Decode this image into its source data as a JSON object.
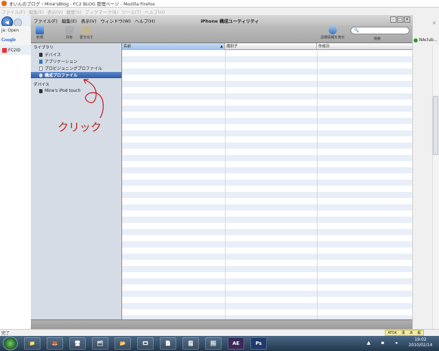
{
  "firefox": {
    "title": "まいんのブログ・Mine'sBlog - FC2 BLOG 管理ページ - Mozilla Firefox",
    "menu": [
      "ファイル(F)",
      "編集(E)",
      "表示(V)",
      "履歴(S)",
      "ブックマーク(B)",
      "ツール(T)",
      "ヘルプ(H)"
    ],
    "left_bar_text": "ja: Open",
    "google_label": "Google",
    "tab_label": "FC2ID",
    "right_toolbar_text": "NAclub...",
    "status_text": "完了",
    "lang_bar": [
      "ATOK",
      "漢",
      "あ",
      "般"
    ],
    "clock_time": "19:02",
    "clock_date": "2010/02/14"
  },
  "app": {
    "menu": [
      "ファイル(F)",
      "編集(E)",
      "表示(V)",
      "ウィンドウ(W)",
      "ヘルプ(H)"
    ],
    "title": "iPhone 構成ユーティリティ",
    "toolbar": {
      "new_label": "新規",
      "share_label": "共有",
      "export_label": "書き出す",
      "info_label": "詳細情報を表示",
      "search_label": "検索",
      "search_icon": "🔍"
    },
    "sidebar": {
      "library_head": "ライブラリ",
      "library_items": [
        "デバイス",
        "アプリケーション",
        "プロビジョニングプロファイル",
        "構成プロファイル"
      ],
      "devices_head": "デバイス",
      "device_items": [
        "Mine's iPod touch"
      ]
    },
    "columns": [
      "名前",
      "識別子",
      "作成日"
    ]
  },
  "annotation": {
    "note": "クリック",
    "color": "#c02020"
  },
  "taskbar": {
    "items": [
      "📁",
      "🦊",
      "🖥",
      "🗂",
      "📂",
      "🎞",
      "📄",
      "🗒",
      "🖼",
      "AE",
      "Ps"
    ]
  }
}
